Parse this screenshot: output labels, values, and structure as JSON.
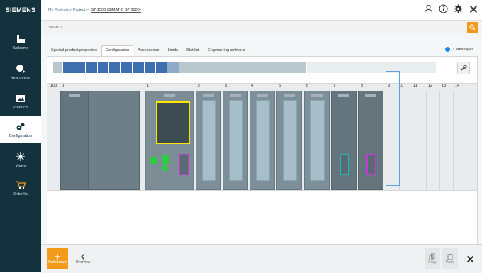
{
  "brand": "SIEMENS",
  "breadcrumb": {
    "part1": "My Projects",
    "part2": "Project",
    "current": "S7-1500 (SIMATIC S7-1500)"
  },
  "search": {
    "placeholder": "Search"
  },
  "nav": [
    {
      "label": "Welcome",
      "icon": "welcome-icon"
    },
    {
      "label": "New device",
      "icon": "new-device-icon"
    },
    {
      "label": "Products",
      "icon": "products-icon"
    },
    {
      "label": "Configuration",
      "icon": "configuration-icon",
      "active": true
    },
    {
      "label": "Views",
      "icon": "views-icon"
    },
    {
      "label": "Order list",
      "icon": "cart-icon"
    }
  ],
  "tabs": [
    {
      "label": "Special product properties"
    },
    {
      "label": "Configuration",
      "active": true
    },
    {
      "label": "Accessories"
    },
    {
      "label": "Limits"
    },
    {
      "label": "Slot list"
    },
    {
      "label": "Engineering software"
    }
  ],
  "messages": {
    "label": "1 Messages"
  },
  "slots": {
    "labels": [
      "100",
      "0",
      "1",
      "2",
      "3",
      "4",
      "5",
      "6",
      "7",
      "8",
      "9",
      "10",
      "11",
      "12",
      "13",
      "14"
    ]
  },
  "bottom": {
    "add_module": "Add module",
    "overview": "Overview",
    "copy": "Copy",
    "paste": "Paste"
  },
  "colors": {
    "accent": "#f39a1a",
    "sidebar": "#13323e",
    "cpu_highlight": "#ffe500",
    "port_green": "#2ecc40",
    "port_magenta": "#c23bd4",
    "port_teal": "#1fb5b5",
    "selection_blue": "#5d9fd8"
  }
}
